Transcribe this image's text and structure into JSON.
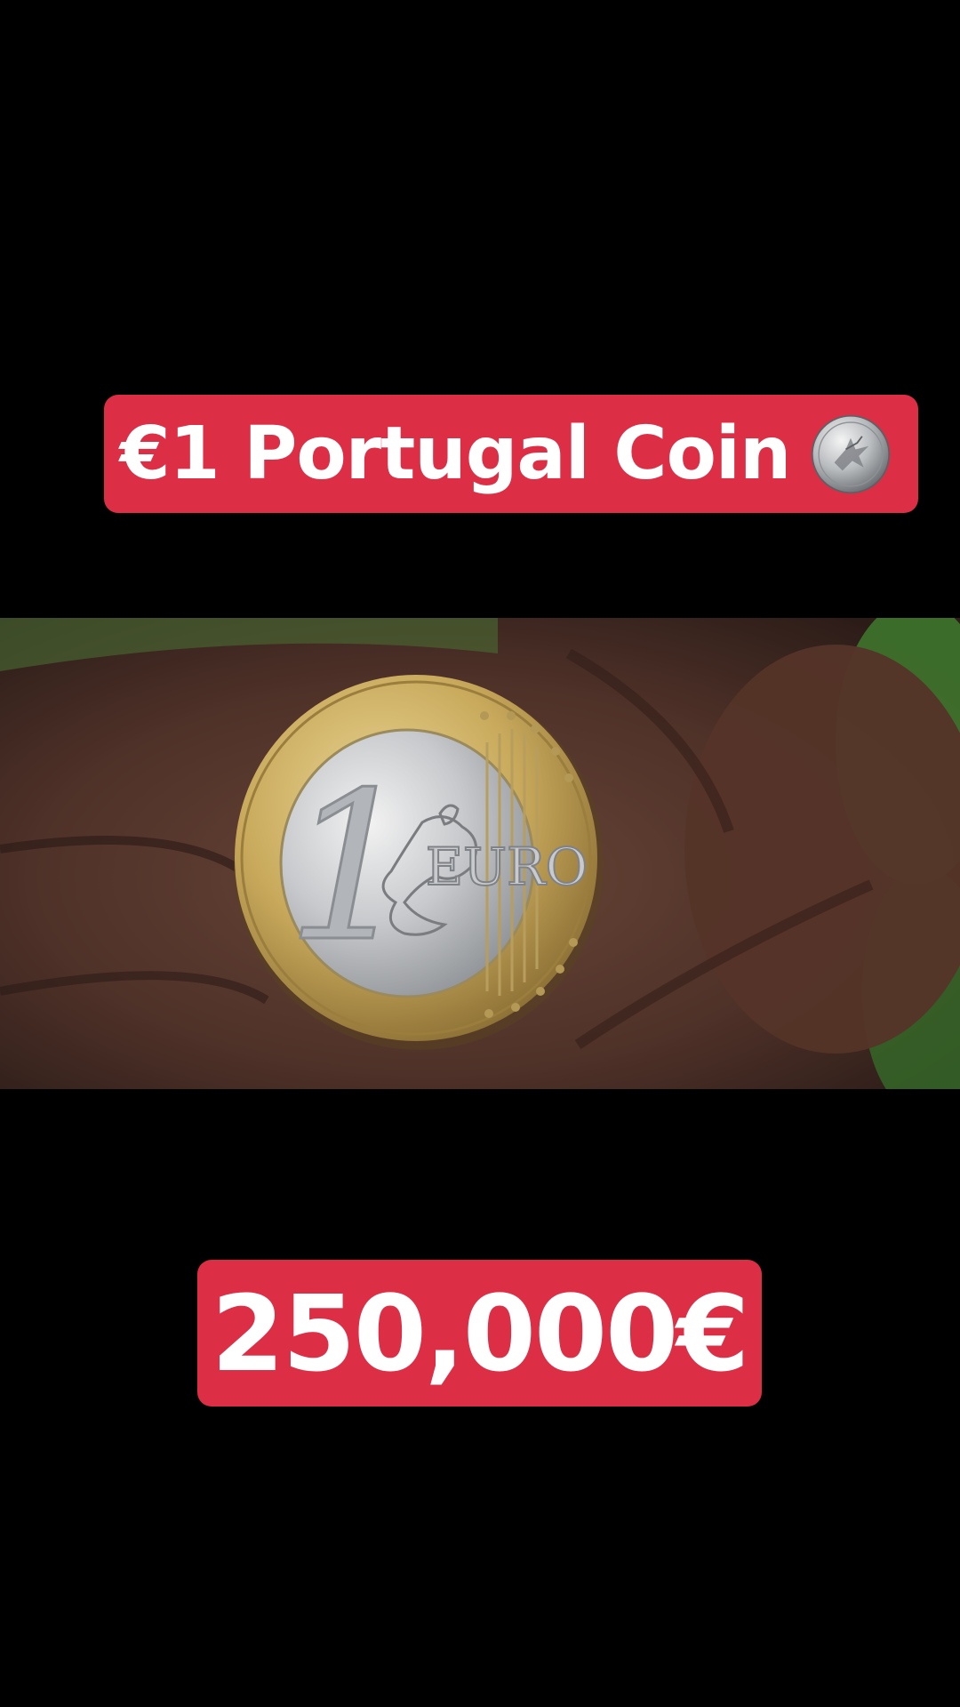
{
  "overlay": {
    "title_text": "€1 Portugal Coin",
    "title_emoji": "coin-icon",
    "price_text": "250,000€"
  },
  "video": {
    "coin_denomination": "1",
    "coin_inscription": "EURO"
  },
  "colors": {
    "caption_background": "#DC2F45",
    "caption_text": "#FFFFFF",
    "page_background": "#000000"
  }
}
